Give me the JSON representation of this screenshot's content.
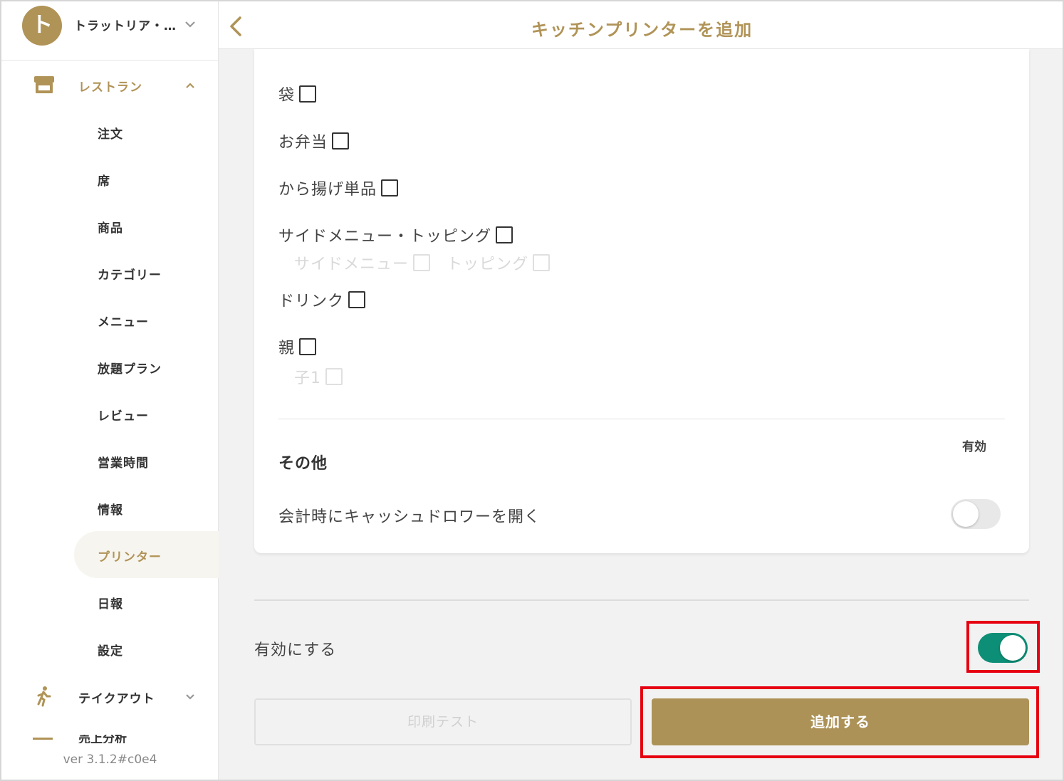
{
  "store": {
    "initial": "ト",
    "name": "トラットリア・…"
  },
  "sidebar": {
    "restaurant_label": "レストラン",
    "items": [
      {
        "label": "注文"
      },
      {
        "label": "席"
      },
      {
        "label": "商品"
      },
      {
        "label": "カテゴリー"
      },
      {
        "label": "メニュー"
      },
      {
        "label": "放題プラン"
      },
      {
        "label": "レビュー"
      },
      {
        "label": "営業時間"
      },
      {
        "label": "情報"
      },
      {
        "label": "プリンター",
        "active": true
      },
      {
        "label": "日報"
      },
      {
        "label": "設定"
      }
    ],
    "takeout_label": "テイクアウト",
    "partial_label": "売上分析",
    "version": "ver 3.1.2#c0e4"
  },
  "header": {
    "title": "キッチンプリンターを追加"
  },
  "categories": [
    {
      "label": "袋",
      "checked": false
    },
    {
      "label": "お弁当",
      "checked": false
    },
    {
      "label": "から揚げ単品",
      "checked": false
    },
    {
      "label": "サイドメニュー・トッピング",
      "checked": false,
      "children": [
        {
          "label": "サイドメニュー",
          "checked": false
        },
        {
          "label": "トッピング",
          "checked": false
        }
      ]
    },
    {
      "label": "ドリンク",
      "checked": false
    },
    {
      "label": "親",
      "checked": false,
      "children": [
        {
          "label": "子1",
          "checked": false
        }
      ]
    }
  ],
  "other": {
    "heading": "その他",
    "enabled_header": "有効",
    "open_cash_drawer_label": "会計時にキャッシュドロワーを開く",
    "open_cash_drawer": false
  },
  "enable": {
    "label": "有効にする",
    "value": true
  },
  "buttons": {
    "print_test": "印刷テスト",
    "add": "追加する"
  },
  "colors": {
    "accent": "#b09357",
    "toggle_on": "#0c8f76",
    "highlight": "#e60012"
  }
}
